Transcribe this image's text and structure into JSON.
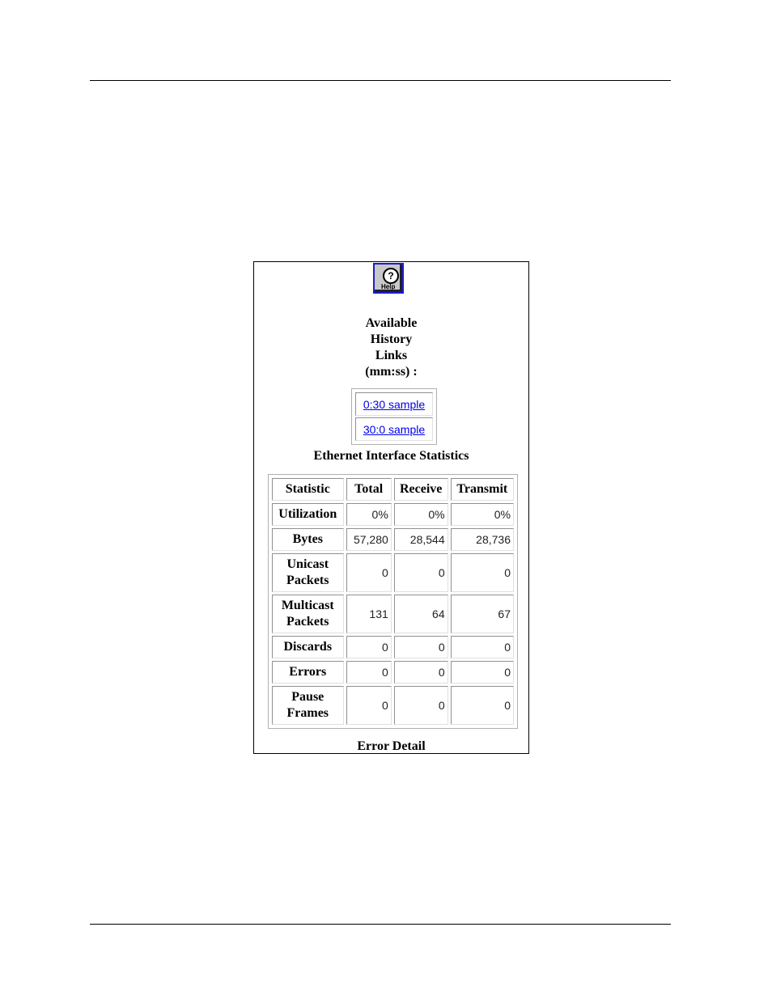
{
  "help_button": {
    "label": "Help",
    "glyph": "?"
  },
  "history": {
    "title_lines": [
      "Available",
      "History",
      "Links",
      "(mm:ss) :"
    ],
    "links": [
      "0:30 sample",
      "30:0 sample"
    ]
  },
  "stats": {
    "title": "Ethernet Interface Statistics",
    "headers": [
      "Statistic",
      "Total",
      "Receive",
      "Transmit"
    ],
    "rows": [
      {
        "label": [
          "Utilization"
        ],
        "values": [
          "0%",
          "0%",
          "0%"
        ]
      },
      {
        "label": [
          "Bytes"
        ],
        "values": [
          "57,280",
          "28,544",
          "28,736"
        ]
      },
      {
        "label": [
          "Unicast",
          "Packets"
        ],
        "values": [
          "0",
          "0",
          "0"
        ]
      },
      {
        "label": [
          "Multicast",
          "Packets"
        ],
        "values": [
          "131",
          "64",
          "67"
        ]
      },
      {
        "label": [
          "Discards"
        ],
        "values": [
          "0",
          "0",
          "0"
        ]
      },
      {
        "label": [
          "Errors"
        ],
        "values": [
          "0",
          "0",
          "0"
        ]
      },
      {
        "label": [
          "Pause",
          "Frames"
        ],
        "values": [
          "0",
          "0",
          "0"
        ]
      }
    ]
  },
  "error_detail_title": "Error Detail"
}
